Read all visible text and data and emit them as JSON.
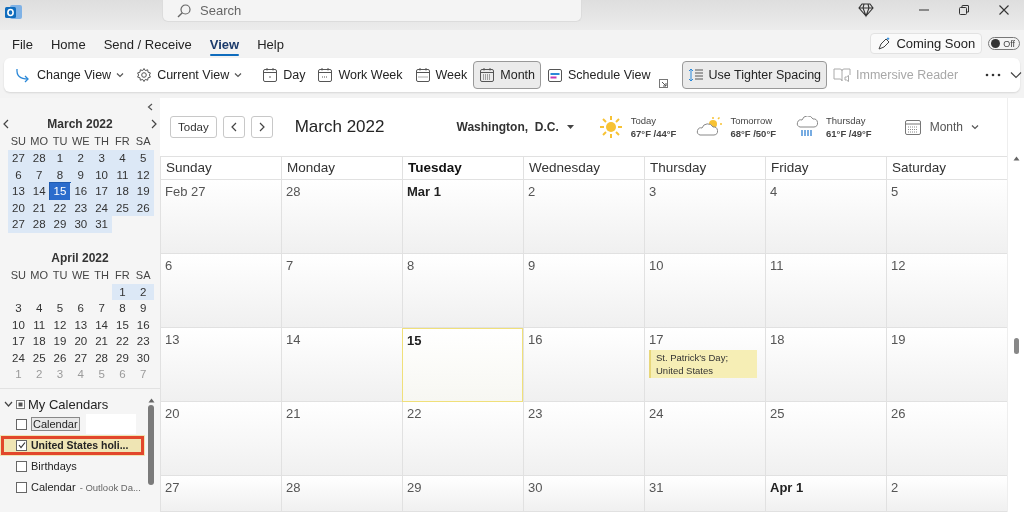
{
  "title_bar": {
    "search": {
      "placeholder": "Search"
    }
  },
  "menu": {
    "tabs": [
      {
        "label": "File",
        "selected": false
      },
      {
        "label": "Home",
        "selected": false
      },
      {
        "label": "Send / Receive",
        "selected": false
      },
      {
        "label": "View",
        "selected": true
      },
      {
        "label": "Help",
        "selected": false
      }
    ],
    "coming_soon": {
      "label": "Coming Soon",
      "toggle": {
        "label": "Off",
        "on": false
      }
    }
  },
  "ribbon": {
    "items": [
      {
        "kind": "button",
        "label": "Change View",
        "dropdown": true,
        "selected": false,
        "disabled": false
      },
      {
        "kind": "button",
        "label": "Current View",
        "dropdown": true,
        "selected": false,
        "disabled": false
      },
      {
        "kind": "separator"
      },
      {
        "kind": "button",
        "label": "Day",
        "dropdown": false,
        "selected": false,
        "disabled": false
      },
      {
        "kind": "button",
        "label": "Work Week",
        "dropdown": false,
        "selected": false,
        "disabled": false
      },
      {
        "kind": "button",
        "label": "Week",
        "dropdown": false,
        "selected": false,
        "disabled": false
      },
      {
        "kind": "button",
        "label": "Month",
        "dropdown": false,
        "selected": true,
        "disabled": false
      },
      {
        "kind": "button",
        "label": "Schedule View",
        "dropdown": false,
        "selected": false,
        "disabled": false
      },
      {
        "kind": "launcher"
      },
      {
        "kind": "separator"
      },
      {
        "kind": "button",
        "label": "Use Tighter Spacing",
        "dropdown": false,
        "selected": true,
        "disabled": false
      },
      {
        "kind": "button",
        "label": "Immersive Reader",
        "dropdown": false,
        "selected": false,
        "disabled": true
      },
      {
        "kind": "separator"
      },
      {
        "kind": "more"
      },
      {
        "kind": "expand"
      }
    ]
  },
  "sidebar": {
    "mini_calendars": [
      {
        "title": "March 2022",
        "weekdays": [
          "SU",
          "MO",
          "TU",
          "WE",
          "TH",
          "FR",
          "SA"
        ],
        "weeks": [
          [
            {
              "day": "27",
              "shaded": true,
              "dim": false,
              "selected": false
            },
            {
              "day": "28",
              "shaded": true,
              "dim": false,
              "selected": false
            },
            {
              "day": "1",
              "shaded": true,
              "dim": false,
              "selected": false
            },
            {
              "day": "2",
              "shaded": true,
              "dim": false,
              "selected": false
            },
            {
              "day": "3",
              "shaded": true,
              "dim": false,
              "selected": false
            },
            {
              "day": "4",
              "shaded": true,
              "dim": false,
              "selected": false
            },
            {
              "day": "5",
              "shaded": true,
              "dim": false,
              "selected": false
            }
          ],
          [
            {
              "day": "6",
              "shaded": true,
              "dim": false,
              "selected": false
            },
            {
              "day": "7",
              "shaded": true,
              "dim": false,
              "selected": false
            },
            {
              "day": "8",
              "shaded": true,
              "dim": false,
              "selected": false
            },
            {
              "day": "9",
              "shaded": true,
              "dim": false,
              "selected": false
            },
            {
              "day": "10",
              "shaded": true,
              "dim": false,
              "selected": false
            },
            {
              "day": "11",
              "shaded": true,
              "dim": false,
              "selected": false
            },
            {
              "day": "12",
              "shaded": true,
              "dim": false,
              "selected": false
            }
          ],
          [
            {
              "day": "13",
              "shaded": true,
              "dim": false,
              "selected": false
            },
            {
              "day": "14",
              "shaded": true,
              "dim": false,
              "selected": false
            },
            {
              "day": "15",
              "shaded": true,
              "dim": false,
              "selected": true
            },
            {
              "day": "16",
              "shaded": true,
              "dim": false,
              "selected": false
            },
            {
              "day": "17",
              "shaded": true,
              "dim": false,
              "selected": false
            },
            {
              "day": "18",
              "shaded": true,
              "dim": false,
              "selected": false
            },
            {
              "day": "19",
              "shaded": true,
              "dim": false,
              "selected": false
            }
          ],
          [
            {
              "day": "20",
              "shaded": true,
              "dim": false,
              "selected": false
            },
            {
              "day": "21",
              "shaded": true,
              "dim": false,
              "selected": false
            },
            {
              "day": "22",
              "shaded": true,
              "dim": false,
              "selected": false
            },
            {
              "day": "23",
              "shaded": true,
              "dim": false,
              "selected": false
            },
            {
              "day": "24",
              "shaded": true,
              "dim": false,
              "selected": false
            },
            {
              "day": "25",
              "shaded": true,
              "dim": false,
              "selected": false
            },
            {
              "day": "26",
              "shaded": true,
              "dim": false,
              "selected": false
            }
          ],
          [
            {
              "day": "27",
              "shaded": true,
              "dim": false,
              "selected": false
            },
            {
              "day": "28",
              "shaded": true,
              "dim": false,
              "selected": false
            },
            {
              "day": "29",
              "shaded": true,
              "dim": false,
              "selected": false
            },
            {
              "day": "30",
              "shaded": true,
              "dim": false,
              "selected": false
            },
            {
              "day": "31",
              "shaded": true,
              "dim": false,
              "selected": false
            }
          ]
        ]
      },
      {
        "title": "April 2022",
        "weekdays": [
          "SU",
          "MO",
          "TU",
          "WE",
          "TH",
          "FR",
          "SA"
        ],
        "weeks": [
          [
            {
              "day": "1",
              "shaded": true,
              "dim": false,
              "selected": false
            },
            {
              "day": "2",
              "shaded": true,
              "dim": false,
              "selected": false
            }
          ],
          [
            {
              "day": "3",
              "shaded": false,
              "dim": false,
              "selected": false
            },
            {
              "day": "4",
              "shaded": false,
              "dim": false,
              "selected": false
            },
            {
              "day": "5",
              "shaded": false,
              "dim": false,
              "selected": false
            },
            {
              "day": "6",
              "shaded": false,
              "dim": false,
              "selected": false
            },
            {
              "day": "7",
              "shaded": false,
              "dim": false,
              "selected": false
            },
            {
              "day": "8",
              "shaded": false,
              "dim": false,
              "selected": false
            },
            {
              "day": "9",
              "shaded": false,
              "dim": false,
              "selected": false
            }
          ],
          [
            {
              "day": "10",
              "shaded": false,
              "dim": false,
              "selected": false
            },
            {
              "day": "11",
              "shaded": false,
              "dim": false,
              "selected": false
            },
            {
              "day": "12",
              "shaded": false,
              "dim": false,
              "selected": false
            },
            {
              "day": "13",
              "shaded": false,
              "dim": false,
              "selected": false
            },
            {
              "day": "14",
              "shaded": false,
              "dim": false,
              "selected": false
            },
            {
              "day": "15",
              "shaded": false,
              "dim": false,
              "selected": false
            },
            {
              "day": "16",
              "shaded": false,
              "dim": false,
              "selected": false
            }
          ],
          [
            {
              "day": "17",
              "shaded": false,
              "dim": false,
              "selected": false
            },
            {
              "day": "18",
              "shaded": false,
              "dim": false,
              "selected": false
            },
            {
              "day": "19",
              "shaded": false,
              "dim": false,
              "selected": false
            },
            {
              "day": "20",
              "shaded": false,
              "dim": false,
              "selected": false
            },
            {
              "day": "21",
              "shaded": false,
              "dim": false,
              "selected": false
            },
            {
              "day": "22",
              "shaded": false,
              "dim": false,
              "selected": false
            },
            {
              "day": "23",
              "shaded": false,
              "dim": false,
              "selected": false
            }
          ],
          [
            {
              "day": "24",
              "shaded": false,
              "dim": false,
              "selected": false
            },
            {
              "day": "25",
              "shaded": false,
              "dim": false,
              "selected": false
            },
            {
              "day": "26",
              "shaded": false,
              "dim": false,
              "selected": false
            },
            {
              "day": "27",
              "shaded": false,
              "dim": false,
              "selected": false
            },
            {
              "day": "28",
              "shaded": false,
              "dim": false,
              "selected": false
            },
            {
              "day": "29",
              "shaded": false,
              "dim": false,
              "selected": false
            },
            {
              "day": "30",
              "shaded": false,
              "dim": false,
              "selected": false
            }
          ],
          [
            {
              "day": "1",
              "shaded": false,
              "dim": true,
              "selected": false
            },
            {
              "day": "2",
              "shaded": false,
              "dim": true,
              "selected": false
            },
            {
              "day": "3",
              "shaded": false,
              "dim": true,
              "selected": false
            },
            {
              "day": "4",
              "shaded": false,
              "dim": true,
              "selected": false
            },
            {
              "day": "5",
              "shaded": false,
              "dim": true,
              "selected": false
            },
            {
              "day": "6",
              "shaded": false,
              "dim": true,
              "selected": false
            },
            {
              "day": "7",
              "shaded": false,
              "dim": true,
              "selected": false
            }
          ]
        ]
      }
    ],
    "calendar_group": {
      "label": "My Calendars",
      "expanded": true,
      "items": [
        {
          "label": "Calendar",
          "checked": false,
          "selected": false,
          "focused": true,
          "annotated": false
        },
        {
          "label": "United States holi...",
          "checked": true,
          "selected": true,
          "focused": false,
          "annotated": true
        },
        {
          "label": "Birthdays",
          "checked": false,
          "selected": false,
          "focused": false,
          "annotated": false
        },
        {
          "label": "Calendar",
          "note": "- Outlook Da...",
          "checked": false,
          "selected": false,
          "focused": false,
          "annotated": false
        }
      ]
    }
  },
  "main": {
    "today_button": "Today",
    "month_title": "March 2022",
    "location": "Washington,  D.C.",
    "forecasts": [
      {
        "kind": "sunny",
        "day": "Today",
        "temps": "67°F /44°F"
      },
      {
        "kind": "partly-cloudy",
        "day": "Tomorrow",
        "temps": "68°F /50°F"
      },
      {
        "kind": "rain",
        "day": "Thursday",
        "temps": "61°F /49°F"
      }
    ],
    "view_switcher": "Month",
    "weekdays": [
      {
        "label": "Sunday",
        "today": false
      },
      {
        "label": "Monday",
        "today": false
      },
      {
        "label": "Tuesday",
        "today": true
      },
      {
        "label": "Wednesday",
        "today": false
      },
      {
        "label": "Thursday",
        "today": false
      },
      {
        "label": "Friday",
        "today": false
      },
      {
        "label": "Saturday",
        "today": false
      }
    ],
    "weeks": [
      [
        {
          "label": "Feb 27",
          "bold": false,
          "today": false
        },
        {
          "label": "28",
          "bold": false,
          "today": false
        },
        {
          "label": "Mar 1",
          "bold": true,
          "today": false
        },
        {
          "label": "2",
          "bold": false,
          "today": false
        },
        {
          "label": "3",
          "bold": false,
          "today": false
        },
        {
          "label": "4",
          "bold": false,
          "today": false
        },
        {
          "label": "5",
          "bold": false,
          "today": false
        }
      ],
      [
        {
          "label": "6",
          "bold": false,
          "today": false
        },
        {
          "label": "7",
          "bold": false,
          "today": false
        },
        {
          "label": "8",
          "bold": false,
          "today": false
        },
        {
          "label": "9",
          "bold": false,
          "today": false
        },
        {
          "label": "10",
          "bold": false,
          "today": false
        },
        {
          "label": "11",
          "bold": false,
          "today": false
        },
        {
          "label": "12",
          "bold": false,
          "today": false
        }
      ],
      [
        {
          "label": "13",
          "bold": false,
          "today": false
        },
        {
          "label": "14",
          "bold": false,
          "today": false
        },
        {
          "label": "15",
          "bold": true,
          "today": true
        },
        {
          "label": "16",
          "bold": false,
          "today": false
        },
        {
          "label": "17",
          "bold": false,
          "today": false,
          "events": [
            "St. Patrick's Day; United States"
          ]
        },
        {
          "label": "18",
          "bold": false,
          "today": false
        },
        {
          "label": "19",
          "bold": false,
          "today": false
        }
      ],
      [
        {
          "label": "20",
          "bold": false,
          "today": false
        },
        {
          "label": "21",
          "bold": false,
          "today": false
        },
        {
          "label": "22",
          "bold": false,
          "today": false
        },
        {
          "label": "23",
          "bold": false,
          "today": false
        },
        {
          "label": "24",
          "bold": false,
          "today": false
        },
        {
          "label": "25",
          "bold": false,
          "today": false
        },
        {
          "label": "26",
          "bold": false,
          "today": false
        }
      ],
      [
        {
          "label": "27",
          "bold": false,
          "today": false
        },
        {
          "label": "28",
          "bold": false,
          "today": false
        },
        {
          "label": "29",
          "bold": false,
          "today": false
        },
        {
          "label": "30",
          "bold": false,
          "today": false
        },
        {
          "label": "31",
          "bold": false,
          "today": false
        },
        {
          "label": "Apr 1",
          "bold": true,
          "today": false
        },
        {
          "label": "2",
          "bold": false,
          "today": false
        }
      ]
    ]
  }
}
